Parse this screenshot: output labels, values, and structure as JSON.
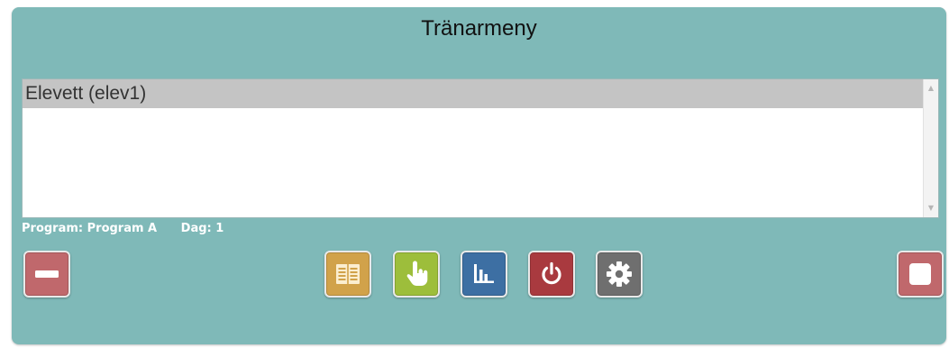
{
  "window": {
    "title": "Tränarmeny"
  },
  "student_list": {
    "items": [
      {
        "label": "Elevett (elev1)",
        "selected": true
      }
    ]
  },
  "status": {
    "program_label": "Program: Program A",
    "day_label": "Dag: 1"
  },
  "toolbar": {
    "buttons": [
      {
        "name": "remove",
        "icon": "minus-icon",
        "color": "#c0686c"
      },
      {
        "name": "program",
        "icon": "book-icon",
        "color": "#d1a24a"
      },
      {
        "name": "touch",
        "icon": "pointer-hand-icon",
        "color": "#9dbe3b"
      },
      {
        "name": "statistics",
        "icon": "bar-chart-icon",
        "color": "#3d6fa3"
      },
      {
        "name": "power",
        "icon": "power-icon",
        "color": "#a93a3f"
      },
      {
        "name": "settings",
        "icon": "gear-icon",
        "color": "#6f6f6f"
      },
      {
        "name": "stop",
        "icon": "stop-square-icon",
        "color": "#c0686c"
      }
    ]
  },
  "colors": {
    "panel_bg": "#7fb9b8",
    "selected_row": "#c4c4c4"
  }
}
